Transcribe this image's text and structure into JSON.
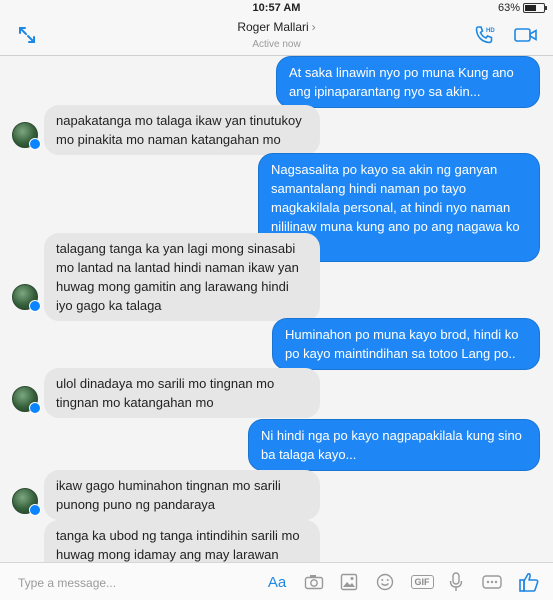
{
  "status_bar": {
    "time": "10:57 AM",
    "battery_percent": "63%",
    "battery_level": 0.63
  },
  "header": {
    "contact_name": "Roger Mallari",
    "chevron": "›",
    "active_status": "Active now"
  },
  "messages": [
    {
      "dir": "out",
      "text": "At saka linawin nyo po muna Kung ano ang ipinaparantang nyo sa akin..."
    },
    {
      "dir": "in",
      "text": "napakatanga mo talaga ikaw yan tinutukoy mo pinakita mo naman katangahan mo"
    },
    {
      "dir": "out",
      "text": "Nagsasalita po kayo sa akin ng ganyan samantalang hindi naman po tayo magkakilala personal, at hindi nyo naman nililinaw muna kung ano po ang nagawa ko sa inyo?"
    },
    {
      "dir": "in",
      "text": "talagang tanga ka yan lagi mong sinasabi mo lantad na lantad hindi naman ikaw yan huwag mong gamitin ang larawang hindi iyo gago ka talaga"
    },
    {
      "dir": "out",
      "text": "Huminahon po muna kayo brod, hindi ko po kayo maintindihan sa totoo Lang po.."
    },
    {
      "dir": "in",
      "text": "ulol dinadaya mo sarili mo tingnan mo tingnan mo katangahan mo"
    },
    {
      "dir": "out",
      "text": "Ni hindi nga po kayo nagpapakilala kung sino ba talaga kayo..."
    },
    {
      "dir": "in",
      "text": "ikaw gago huminahon tingnan mo sarili punong puno ng pandaraya"
    },
    {
      "dir": "in",
      "text": "tanga ka ubod ng tanga intindihin sarili mo huwag mong idamay ang may larawan hindi"
    }
  ],
  "composer": {
    "placeholder": "Type a message...",
    "text_format_label": "Aa",
    "gif_label": "GIF"
  },
  "icons": {
    "expand": "expand-arrows-icon",
    "call": "phone-hd-icon",
    "video": "video-camera-icon",
    "camera": "camera-icon",
    "gallery": "photo-gallery-icon",
    "emoji": "emoji-icon",
    "microphone": "microphone-icon",
    "more": "more-icon",
    "like": "thumbs-up-icon"
  },
  "colors": {
    "accent": "#1e88e5",
    "outgoing_bubble": "#1f87f5",
    "incoming_bubble": "#e6e6e6"
  }
}
